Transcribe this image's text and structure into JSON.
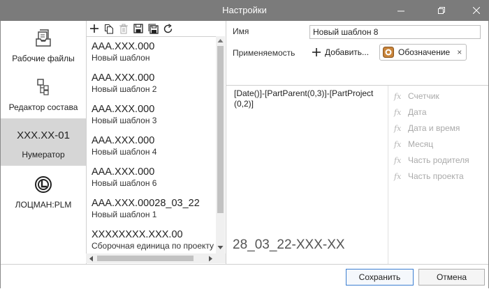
{
  "window": {
    "title": "Настройки"
  },
  "sidebar": {
    "items": [
      {
        "label": "Рабочие файлы",
        "icon": "file-tray-icon"
      },
      {
        "label": "Редактор состава",
        "icon": "structure-editor-icon"
      },
      {
        "label": "Нумератор",
        "big": "XXX.XX-01",
        "icon": "numerator-icon"
      },
      {
        "label": "ЛОЦМАН:PLM",
        "icon": "lotsman-logo-icon"
      }
    ]
  },
  "toolbar": {
    "buttons": [
      "add-icon",
      "copy-icon",
      "delete-icon",
      "save-icon",
      "save-all-icon",
      "refresh-icon"
    ]
  },
  "templates": [
    {
      "code": "AAA.XXX.000",
      "name": "Новый шаблон"
    },
    {
      "code": "AAA.XXX.000",
      "name": "Новый шаблон 2"
    },
    {
      "code": "AAA.XXX.000",
      "name": "Новый шаблон 3"
    },
    {
      "code": "AAA.XXX.000",
      "name": "Новый шаблон 4"
    },
    {
      "code": "AAA.XXX.000",
      "name": "Новый шаблон 6"
    },
    {
      "code": "AAA.XXX.00028_03_22",
      "name": "Новый шаблон 1"
    },
    {
      "code": "XXXXXXXX.XXX.00",
      "name": "Сборочная единица по проекту"
    }
  ],
  "props": {
    "name_label": "Имя",
    "name_value": "Новый шаблон 8",
    "applicability_label": "Применяемость",
    "add_label": "Добавить...",
    "chip_label": "Обозначение",
    "chip_close": "×"
  },
  "editor": {
    "formula": "[Date()]-[PartParent(0,3)]-[PartProject(0,2)]",
    "preview": "28_03_22-XXX-XX"
  },
  "functions": [
    {
      "fx": "fx",
      "label": "Счетчик"
    },
    {
      "fx": "fx",
      "label": "Дата"
    },
    {
      "fx": "fx",
      "label": "Дата и время"
    },
    {
      "fx": "fx",
      "label": "Месяц"
    },
    {
      "fx": "fx",
      "label": "Часть родителя"
    },
    {
      "fx": "fx",
      "label": "Часть проекта"
    }
  ],
  "footer": {
    "save_label": "Сохранить",
    "cancel_label": "Отмена"
  },
  "colors": {
    "titlebar": "#7b7b7b",
    "active_item": "#d6d6d6",
    "primary_border": "#3c7fd1"
  }
}
